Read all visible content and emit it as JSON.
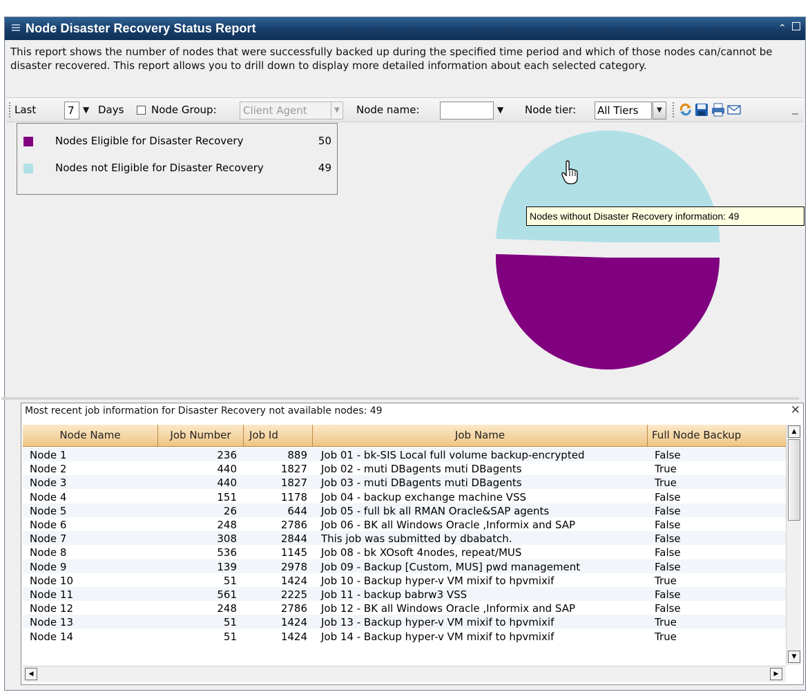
{
  "window": {
    "title": "Node Disaster Recovery Status Report",
    "description": "This report shows the number of nodes that were successfully backed up during the specified time period and which of those nodes can/cannot be disaster recovered. This report allows you to drill down to display more detailed information about each selected category."
  },
  "toolbar": {
    "last_label": "Last",
    "days_value": "7",
    "days_label": "Days",
    "node_group_label": "Node Group:",
    "node_group_value": "Client Agent",
    "node_name_label": "Node name:",
    "node_name_value": "",
    "node_tier_label": "Node tier:",
    "node_tier_value": "All Tiers",
    "icons": [
      "refresh-icon",
      "save-icon",
      "print-icon",
      "email-icon"
    ]
  },
  "legend": {
    "items": [
      {
        "label": "Nodes Eligible for Disaster Recovery",
        "value": "50",
        "color": "#800080"
      },
      {
        "label": "Nodes not Eligible for Disaster Recovery",
        "value": "49",
        "color": "#b0e0e6"
      }
    ]
  },
  "chart_data": {
    "type": "pie",
    "categories": [
      "Nodes Eligible for Disaster Recovery",
      "Nodes not Eligible for Disaster Recovery"
    ],
    "values": [
      50,
      49
    ],
    "colors": [
      "#800080",
      "#b0e0e6"
    ],
    "exploded": "Nodes not Eligible for Disaster Recovery",
    "legend_position": "top-left"
  },
  "tooltip": {
    "text": "Nodes without Disaster Recovery information: 49"
  },
  "grid": {
    "title": "Most recent job information for Disaster Recovery not available nodes: 49",
    "columns": [
      "Node Name",
      "Job Number",
      "Job Id",
      "Job Name",
      "Full Node Backup"
    ],
    "rows": [
      [
        "Node 1",
        "236",
        "889",
        "Job 01 -  bk-SIS Local full volume backup-encrypted",
        "False"
      ],
      [
        "Node 2",
        "440",
        "1827",
        "Job 02 -  muti DBagents muti DBagents",
        "True"
      ],
      [
        "Node 3",
        "440",
        "1827",
        "Job 03 -  muti DBagents muti DBagents",
        "True"
      ],
      [
        "Node 4",
        "151",
        "1178",
        "Job 04 -  backup exchange machine VSS",
        "False"
      ],
      [
        "Node 5",
        "26",
        "644",
        "Job 05 -  full bk all RMAN Oracle&SAP agents",
        "False"
      ],
      [
        "Node 6",
        "248",
        "2786",
        "Job 06 -  BK all Windows Oracle ,Informix and SAP",
        "False"
      ],
      [
        "Node 7",
        "308",
        "2844",
        "This job was submitted by dbabatch.",
        "False"
      ],
      [
        "Node 8",
        "536",
        "1145",
        "Job 08 -  bk XOsoft 4nodes, repeat/MUS",
        "False"
      ],
      [
        "Node 9",
        "139",
        "2978",
        "Job 09 -  Backup [Custom, MUS]  pwd management",
        "False"
      ],
      [
        "Node 10",
        "51",
        "1424",
        "Job 10 - Backup hyper-v VM mixif to hpvmixif",
        "True"
      ],
      [
        "Node 11",
        "561",
        "2225",
        "Job 11 -  backup babrw3 VSS",
        "False"
      ],
      [
        "Node 12",
        "248",
        "2786",
        "Job 12 -  BK all Windows Oracle ,Informix and  SAP",
        "False"
      ],
      [
        "Node 13",
        "51",
        "1424",
        "Job 13 - Backup hyper-v VM mixif to hpvmixif",
        "True"
      ],
      [
        "Node 14",
        "51",
        "1424",
        "Job 14 - Backup hyper-v VM mixif to hpvmixif",
        "True"
      ]
    ]
  }
}
